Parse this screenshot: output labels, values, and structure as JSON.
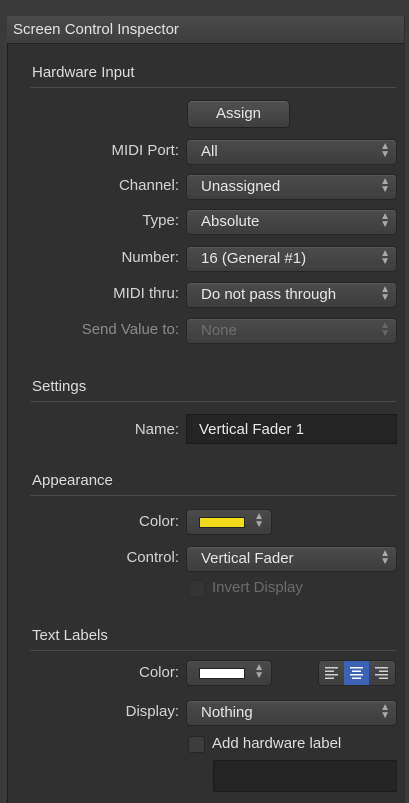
{
  "window": {
    "title": "Screen Control Inspector"
  },
  "hardware_input": {
    "section_title": "Hardware Input",
    "assign_label": "Assign",
    "midi_port": {
      "label": "MIDI Port:",
      "value": "All"
    },
    "channel": {
      "label": "Channel:",
      "value": "Unassigned"
    },
    "type": {
      "label": "Type:",
      "value": "Absolute"
    },
    "number": {
      "label": "Number:",
      "value": "16 (General #1)"
    },
    "midi_thru": {
      "label": "MIDI thru:",
      "value": "Do not pass through"
    },
    "send_value_to": {
      "label": "Send Value to:",
      "value": "None"
    }
  },
  "settings": {
    "section_title": "Settings",
    "name": {
      "label": "Name:",
      "value": "Vertical Fader 1"
    }
  },
  "appearance": {
    "section_title": "Appearance",
    "color": {
      "label": "Color:",
      "swatch": "#f2dc1a"
    },
    "control": {
      "label": "Control:",
      "value": "Vertical Fader"
    },
    "invert_display": {
      "label": "Invert Display",
      "checked": false
    }
  },
  "text_labels": {
    "section_title": "Text Labels",
    "color": {
      "label": "Color:",
      "swatch": "#ffffff"
    },
    "alignment": {
      "options": [
        "left",
        "center",
        "right"
      ],
      "selected": "center"
    },
    "display": {
      "label": "Display:",
      "value": "Nothing"
    },
    "add_hardware_label": {
      "label": "Add hardware label",
      "checked": false
    },
    "hardware_label_field": {
      "value": ""
    }
  },
  "colors": {
    "accent": "#3b62b5",
    "panel": "#303030"
  }
}
